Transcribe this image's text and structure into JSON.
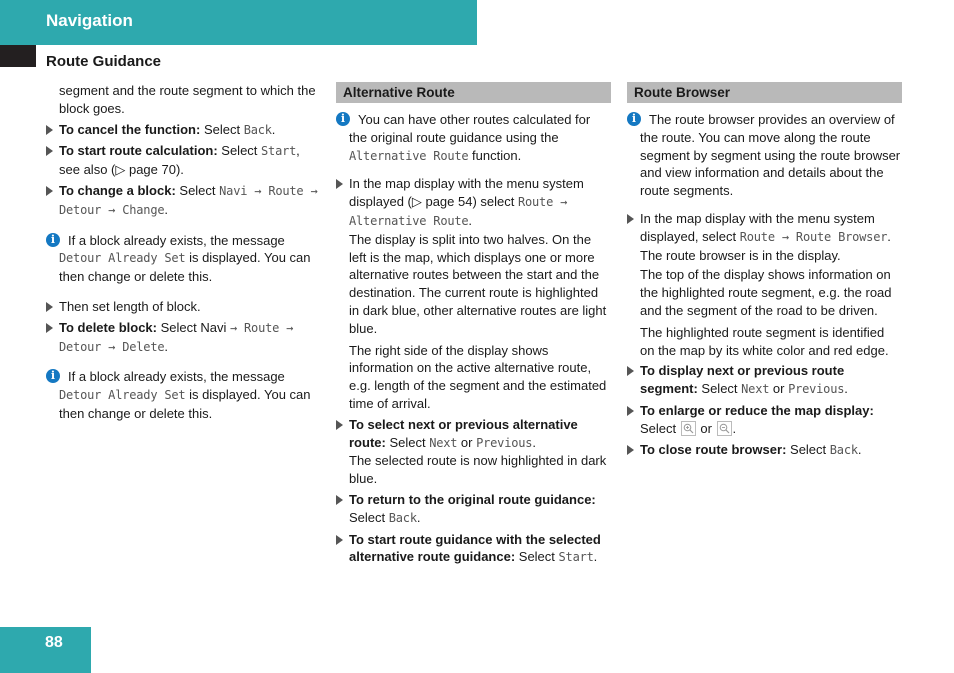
{
  "header": {
    "title": "Navigation",
    "accent_color": "#2ea9ae"
  },
  "section": {
    "title": "Route Guidance"
  },
  "column1": {
    "intro": "segment and the route segment to which the block goes.",
    "steps": [
      {
        "bold": "To cancel the function:",
        "pre": " Select ",
        "mono": "Back",
        "post": "."
      },
      {
        "bold": "To start route calculation:",
        "pre": " Select ",
        "mono": "Start",
        "post": ", see also (▷ page 70)."
      },
      {
        "bold": "To change a block:",
        "pre": " Select ",
        "mono": "Navi → Route → Detour → Change",
        "post": "."
      }
    ],
    "note1": {
      "mono": "Detour Already Set",
      "pre": "If a block already exists, the message ",
      "post": " is displayed. You can then change or delete this."
    },
    "step_length": "Then set length of block.",
    "step_delete": {
      "bold": "To delete block:",
      "pre": " Select Navi ",
      "mono": "→ Route → Detour → Delete",
      "post": "."
    },
    "note2": {
      "mono": "Detour Already Set",
      "pre": "If a block already exists, the message ",
      "post": " is displayed. You can then change or delete this."
    }
  },
  "column2": {
    "heading": "Alternative Route",
    "note": {
      "pre": "You can have other routes calculated for the original route guidance using the ",
      "mono": "Alternative Route",
      "post": " function."
    },
    "step1": {
      "pre": "In the map display with the menu system displayed (▷ page 54) select ",
      "mono": "Route → Alternative Route",
      "post": "."
    },
    "para1": "The display is split into two halves. On the left is the map, which displays one or more alternative routes between the start and the destination. The current route is highlighted in dark blue, other alternative routes are light blue.",
    "para2": "The right side of the display shows information on the active alternative route, e.g. length of the segment and the estimated time of arrival.",
    "step2": {
      "bold": "To select next or previous alternative route:",
      "pre": " Select ",
      "mono1": "Next",
      "mid": " or ",
      "mono2": "Previous",
      "post": "."
    },
    "step2_sub": "The selected route is now highlighted in dark blue.",
    "step3": {
      "bold": "To return to the original route guidance:",
      "pre": " Select ",
      "mono": "Back",
      "post": "."
    },
    "step4": {
      "bold": "To start route guidance with the selected alternative route guidance:",
      "pre": " Select ",
      "mono": "Start",
      "post": "."
    }
  },
  "column3": {
    "heading": "Route Browser",
    "note": "The route browser provides an overview of the route. You can move along the route segment by segment using the route browser and view information and details about the route segments.",
    "step1": {
      "pre": "In the map display with the menu system displayed, select ",
      "mono": "Route → Route Browser",
      "post": "."
    },
    "sub1": "The route browser is in the display.",
    "sub2": "The top of the display shows information on the highlighted route segment, e.g. the road and the segment of the road to be driven.",
    "sub3": "The highlighted route segment is identified on the map by its white color and red edge.",
    "step2": {
      "bold": "To display next or previous route segment:",
      "pre": " Select ",
      "mono1": "Next",
      "mid": " or ",
      "mono2": "Previous",
      "post": "."
    },
    "step3": {
      "bold": "To enlarge or reduce the map display:",
      "pre": " Select ",
      "mid": " or ",
      "post": ".",
      "icon1": "zoom-in-icon",
      "icon2": "zoom-out-icon"
    },
    "step4": {
      "bold": "To close route browser:",
      "pre": " Select ",
      "mono": "Back",
      "post": "."
    }
  },
  "footer": {
    "page_number": "88"
  }
}
